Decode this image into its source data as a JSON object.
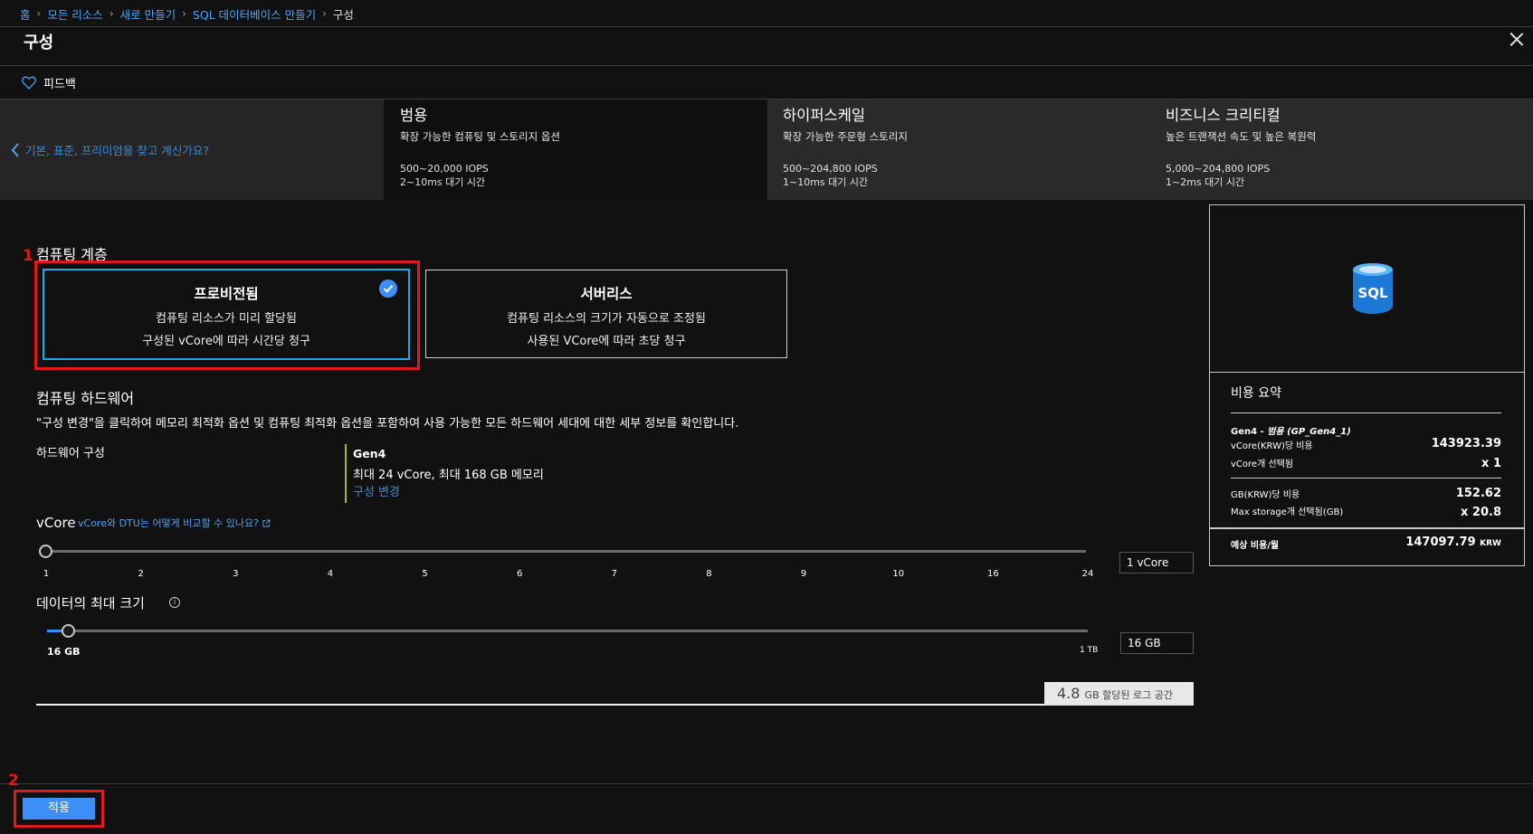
{
  "breadcrumb": {
    "items": [
      "홈",
      "모든 리소스",
      "새로 만들기",
      "SQL 데이터베이스 만들기"
    ],
    "current": "구성"
  },
  "page": {
    "title": "구성"
  },
  "feedback": {
    "label": "피드백"
  },
  "tiers": {
    "back_link": "기본, 표준, 프리미엄을 찾고 계신가요?",
    "items": [
      {
        "name": "범용",
        "desc": "확장 가능한 컴퓨팅 및 스토리지 옵션",
        "iops": "500~20,000 IOPS",
        "latency": "2~10ms 대기 시간",
        "selected": true
      },
      {
        "name": "하이퍼스케일",
        "desc": "확장 가능한 주문형 스토리지",
        "iops": "500~204,800 IOPS",
        "latency": "1~10ms 대기 시간",
        "selected": false
      },
      {
        "name": "비즈니스 크리티컬",
        "desc": "높은 트랜잭션 속도 및 높은 복원력",
        "iops": "5,000~204,800 IOPS",
        "latency": "1~2ms 대기 시간",
        "selected": false
      }
    ]
  },
  "compute_tier": {
    "heading": "컴퓨팅 계층",
    "marker": "1",
    "provisioned": {
      "title": "프로비전됨",
      "line1": "컴퓨팅 리소스가 미리 할당됨",
      "line2": "구성된 vCore에 따라 시간당 청구"
    },
    "serverless": {
      "title": "서버리스",
      "line1": "컴퓨팅 리소스의 크기가 자동으로 조정됨",
      "line2": "사용된 VCore에 따라 초당 청구"
    }
  },
  "hardware": {
    "heading": "컴퓨팅 하드웨어",
    "desc": "\"구성 변경\"을 클릭하여 메모리 최적화 옵션 및 컴퓨팅 최적화 옵션을 포함하여 사용 가능한 모든 하드웨어 세대에 대한 세부 정보를 확인합니다.",
    "config_label": "하드웨어 구성",
    "gen": "Gen4",
    "spec": "최대 24 vCore, 최대 168 GB 메모리",
    "change_link": "구성 변경"
  },
  "vcore": {
    "label": "vCore",
    "compare_link": "vCore와 DTU는 어떻게 비교할 수 있나요?",
    "ticks": [
      "1",
      "2",
      "3",
      "4",
      "5",
      "6",
      "7",
      "8",
      "9",
      "10",
      "16",
      "24"
    ],
    "selected_index": 0,
    "value": "1 vCore"
  },
  "max_size": {
    "label": "데이터의 최대 크기",
    "min_label": "16 GB",
    "max_label": "1 TB",
    "fill_fraction": 0.015,
    "value": "16 GB"
  },
  "log": {
    "amount": "4.8",
    "unit_text": "GB 할당된 로그 공간"
  },
  "summary": {
    "heading": "비용 요약",
    "icon_text": "SQL",
    "gen_line_a": "Gen4 - ",
    "gen_line_b": "범용 (GP_Gen4_1)",
    "vcore_cost_label": "vCore(KRW)당 비용",
    "vcore_cost": "143923.39",
    "vcore_count_label": "vCore개 선택됨",
    "vcore_count": "x 1",
    "gb_cost_label": "GB(KRW)당 비용",
    "gb_cost": "152.62",
    "storage_label": "Max storage개 선택됨(GB)",
    "storage_mult": "x 20.8",
    "monthly_label": "예상 비용/월",
    "monthly_value": "147097.79",
    "currency": "KRW"
  },
  "footer": {
    "apply_label": "적용",
    "marker": "2"
  },
  "colors": {
    "accent": "#3e8ef7",
    "link": "#4fa3f7",
    "highlight": "#e01a1a",
    "selected_border": "#20a8e8"
  }
}
